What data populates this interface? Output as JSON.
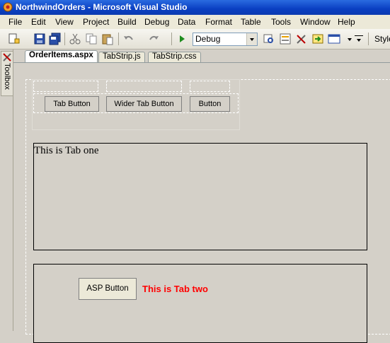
{
  "window": {
    "title": "NorthwindOrders - Microsoft Visual Studio"
  },
  "menu": [
    "File",
    "Edit",
    "View",
    "Project",
    "Build",
    "Debug",
    "Data",
    "Format",
    "Table",
    "Tools",
    "Window",
    "Help"
  ],
  "toolbar": {
    "config_value": "Debug",
    "style_label": "Style"
  },
  "toolbox": {
    "label": "Toolbox"
  },
  "doc_tabs": [
    "OrderItems.aspx",
    "TabStrip.js",
    "TabStrip.css"
  ],
  "tabstrip": {
    "buttons": [
      "Tab Button",
      "Wider Tab Button",
      "Button"
    ]
  },
  "panel_one": {
    "text": "This is Tab one"
  },
  "panel_two": {
    "button_label": "ASP Button",
    "label": "This is Tab two"
  },
  "colors": {
    "titlebar": "#0a3fc2",
    "tab_two_label": "#ff0000"
  }
}
